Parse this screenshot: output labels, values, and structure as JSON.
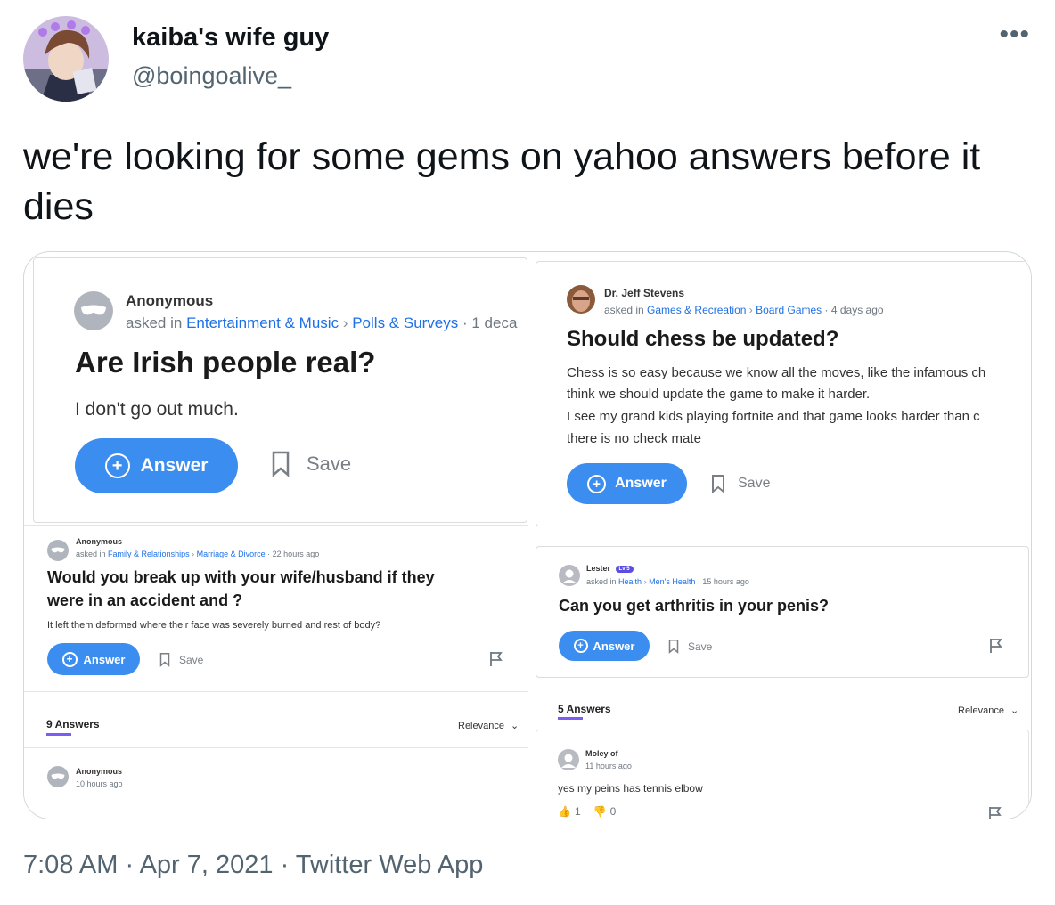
{
  "tweet": {
    "display_name": "kaiba's wife guy",
    "handle": "@boingoalive_",
    "more_icon": "•••",
    "text": "we're looking for some gems on yahoo answers before it dies",
    "footer": "7:08 AM · Apr 7, 2021 · Twitter Web App"
  },
  "q1": {
    "author": "Anonymous",
    "asked_in": "asked in",
    "cat1": "Entertainment & Music",
    "cat2": "Polls & Surveys",
    "time": "· 1 deca",
    "title": "Are Irish people real?",
    "body": "I don't go out much.",
    "answer_label": "Answer",
    "save_label": "Save"
  },
  "q2": {
    "author": "Dr. Jeff Stevens",
    "asked_in": "asked in",
    "cat1": "Games & Recreation",
    "cat2": "Board Games",
    "time": "· 4 days ago",
    "title": "Should chess be updated?",
    "line1": "Chess is so easy because we know all the moves, like the infamous ch",
    "line2": "think we should update the game to make it harder.",
    "line3": "I see my grand kids playing fortnite and that game looks harder than c",
    "line4": "there is no check mate",
    "answer_label": "Answer",
    "save_label": "Save"
  },
  "q3": {
    "author": "Anonymous",
    "asked_in": "asked in",
    "cat1": "Family & Relationships",
    "cat2": "Marriage & Divorce",
    "time": "· 22 hours ago",
    "title_line1": "Would you break up with your wife/husband if they",
    "title_line2": "were in an accident and ?",
    "body": "It left them deformed where their face was severely burned and rest of body?",
    "answer_label": "Answer",
    "save_label": "Save",
    "answers_count": "9 Answers",
    "sort": "Relevance",
    "reply_author": "Anonymous",
    "reply_time": "10 hours ago"
  },
  "q4": {
    "author": "Lester",
    "level": "Lv 5",
    "asked_in": "asked in",
    "cat1": "Health",
    "cat2": "Men's Health",
    "time": "· 15 hours ago",
    "title": "Can you get arthritis in your penis?",
    "answer_label": "Answer",
    "save_label": "Save",
    "answers_count": "5 Answers",
    "sort": "Relevance",
    "reply_author": "Moley of",
    "reply_time": "11 hours ago",
    "reply_text": "yes my peins has tennis elbow",
    "likes": "1",
    "dislikes": "0"
  },
  "colors": {
    "accent": "#3b8ef0",
    "link": "#1e70e8",
    "underline": "#7b5cf5"
  }
}
